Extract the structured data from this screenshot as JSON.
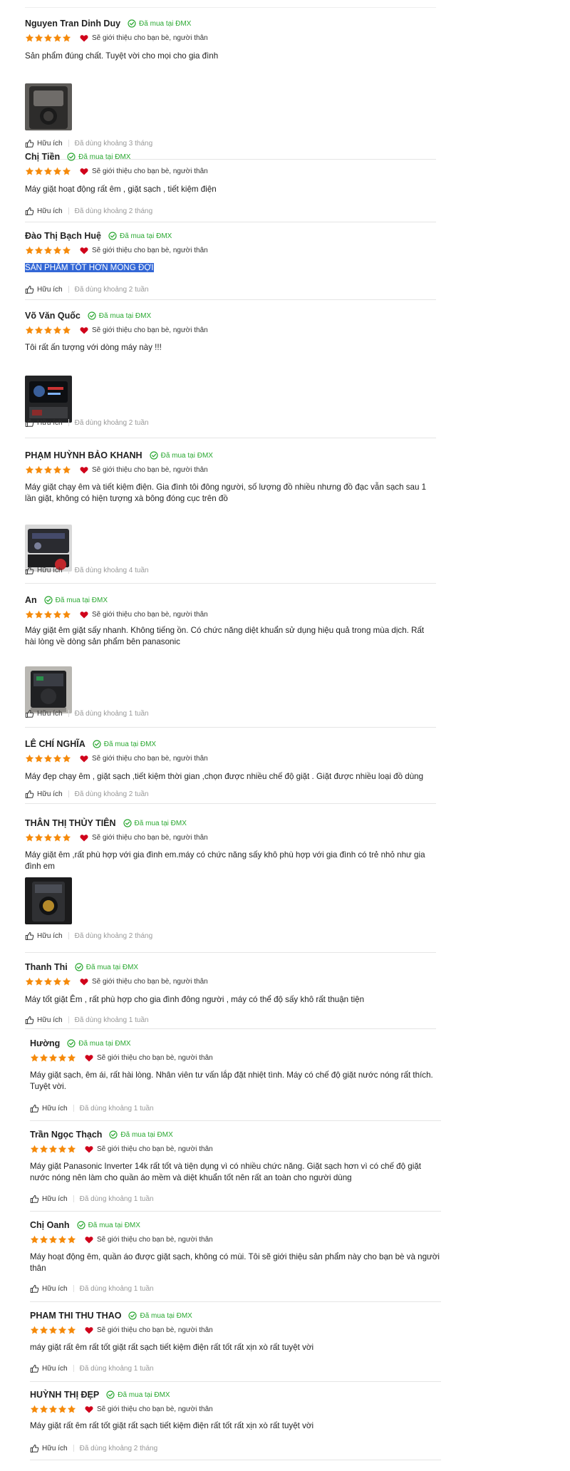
{
  "colors": {
    "star": "#f58a0b",
    "heart": "#d0021b",
    "badge": "#2ba832",
    "highlight": "#3367d6"
  },
  "labels": {
    "bought": "Đã mua tại ĐMX",
    "recommend": "Sẽ giới thiệu cho bạn bè, người thân",
    "helpful": "Hữu ích"
  },
  "reviews": [
    {
      "name": "Nguyen Tran Dinh Duy",
      "stars": 5,
      "text": "Sản phẩm đúng chất. Tuyệt vời cho mọi cho gia đình",
      "photo": "dark-machine",
      "used": "Đã dùng khoảng 3 tháng"
    },
    {
      "name": "Chị Tiền",
      "stars": 5,
      "text": "Máy giặt hoạt động rất êm , giặt sạch , tiết kiệm điện",
      "used": "Đã dùng khoảng 2 tháng"
    },
    {
      "name": "Đào Thị Bạch Huệ",
      "stars": 5,
      "text": "SẢN PHẨM TỐT HƠN MONG ĐỢI",
      "highlighted": true,
      "used": "Đã dùng khoảng 2 tuần"
    },
    {
      "name": "Võ Văn Quốc",
      "stars": 5,
      "text": "Tôi rất ấn tượng với dòng máy này !!!",
      "photo": "control-panel",
      "used": "Đã dùng khoảng 2 tuần"
    },
    {
      "name": "PHẠM HUỲNH BẢO KHANH",
      "stars": 5,
      "text": "Máy giặt chạy êm và tiết kiệm điện. Gia đình tôi đông người, số lượng đồ nhiều nhưng đồ đạc vẫn sạch sau 1 lần giặt, không có hiện tượng xà bông đóng cục trên đồ",
      "photo": "panel-red",
      "used": "Đã dùng khoảng 4 tuần"
    },
    {
      "name": "An",
      "stars": 5,
      "text": "Máy giặt êm giặt sấy nhanh. Không tiếng ồn. Có chức năng diệt khuẩn sử dụng hiệu quả trong mùa dịch. Rất hài lòng về dòng sản phẩm bên panasonic",
      "photo": "top-view",
      "used": "Đã dùng khoảng 1 tuần"
    },
    {
      "name": "LÊ CHÍ NGHĨA",
      "stars": 5,
      "text": "Máy đẹp chạy êm , giặt sạch ,tiết kiệm thời gian ,chọn được nhiều chế độ giặt . Giặt được nhiều loại đồ dùng",
      "used": "Đã dùng khoảng 2 tuần"
    },
    {
      "name": "THÂN THỊ THỦY TIÊN",
      "stars": 5,
      "text": "Máy giặt êm ,rất phù hợp với gia đình em.máy có chức năng sấy khô phù hợp với gia đình có trẻ nhỏ như gia đình em",
      "photo": "front-dark",
      "used": "Đã dùng khoảng 2 tháng"
    },
    {
      "name": "Thanh Thi",
      "stars": 5,
      "text": "Máy tốt giặt Êm , rất phù hợp cho gia đình đông người , máy có thể độ sấy khô rất thuận tiện",
      "used": "Đã dùng khoảng 1 tuần"
    },
    {
      "name": "Hường",
      "stars": 5,
      "text": "Máy giặt sạch, êm ái, rất hài lòng. Nhân viên tư vấn lắp đặt nhiệt tình. Máy có chế độ giặt nước nóng rất thích. Tuyệt vời.",
      "used": "Đã dùng khoảng 1 tuần"
    },
    {
      "name": "Trần Ngọc Thạch",
      "stars": 5,
      "text": "Máy giặt Panasonic Inverter 14k rất tốt và tiện dụng vì có nhiều chức năng. Giặt sạch hơn vì có chế độ giặt nước nóng nên làm cho quần áo mềm và diệt khuẩn tốt nên rất an toàn cho người dùng",
      "used": "Đã dùng khoảng 1 tuần"
    },
    {
      "name": "Chị Oanh",
      "stars": 5,
      "text": "Máy hoạt động êm, quần áo được giặt sạch, không có mùi. Tôi sẽ giới thiệu sản phẩm này cho bạn bè và người thân",
      "used": "Đã dùng khoảng 1 tuần"
    },
    {
      "name": "PHAM THI THU THAO",
      "stars": 5,
      "text": "máy giặt rất êm rất tốt giặt rất sạch tiết kiệm điện rất tốt rất xịn xò rất tuyệt vời",
      "used": "Đã dùng khoảng 1 tuần"
    },
    {
      "name": "HUỲNH THỊ ĐẸP",
      "stars": 5,
      "text": "Máy giặt rất êm rất tốt giặt rất sạch tiết kiệm điện rất tốt rất xịn xò rất tuyệt vời",
      "used": "Đã dùng khoảng 2 tháng"
    }
  ]
}
